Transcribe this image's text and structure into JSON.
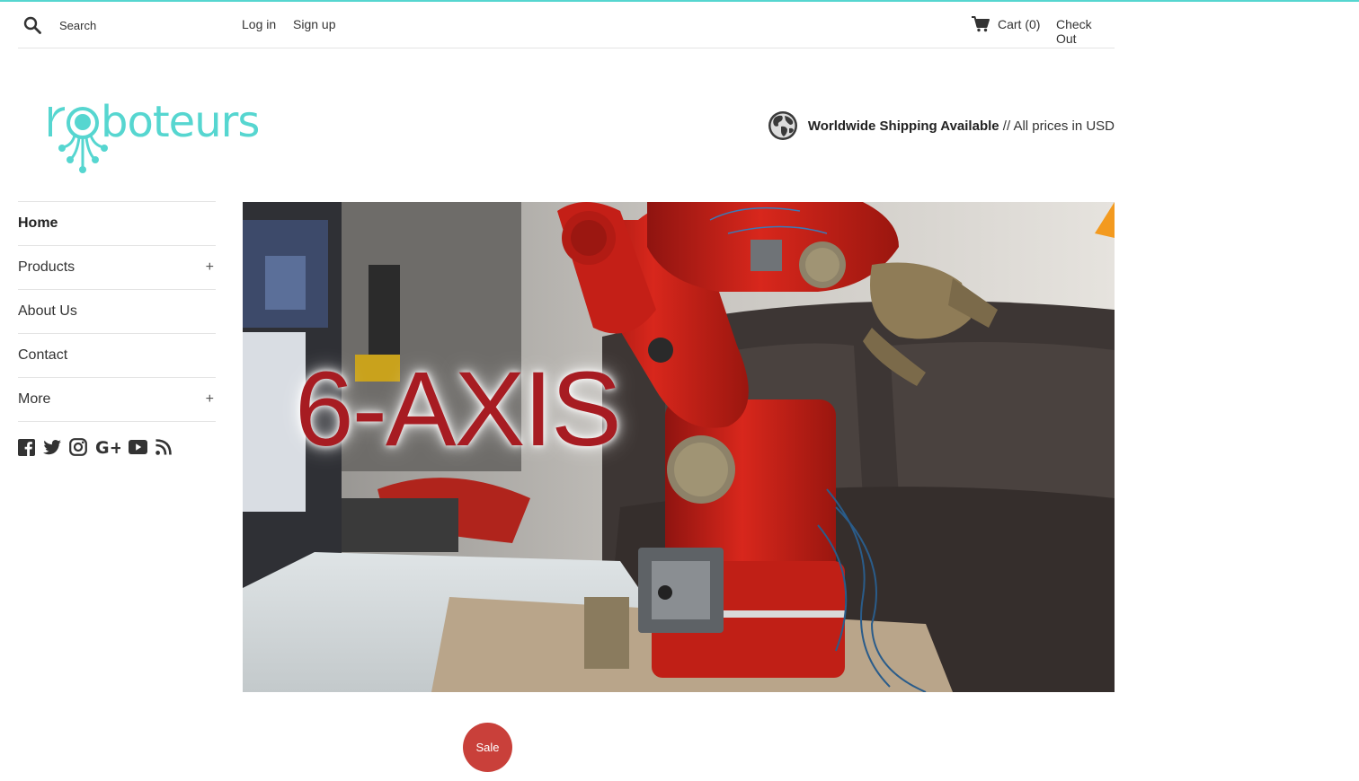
{
  "header": {
    "search_placeholder": "Search",
    "login": "Log in",
    "signup": "Sign up",
    "cart": "Cart (0)",
    "checkout": "Check Out"
  },
  "brand": {
    "logo_text": "roboteurs",
    "accent_color": "#56d6d0"
  },
  "shipping": {
    "bold": "Worldwide Shipping Available",
    "rest": " // All prices in USD"
  },
  "sidebar": {
    "items": [
      {
        "label": "Home",
        "active": true,
        "expandable": false
      },
      {
        "label": "Products",
        "active": false,
        "expandable": true
      },
      {
        "label": "About Us",
        "active": false,
        "expandable": false
      },
      {
        "label": "Contact",
        "active": false,
        "expandable": false
      },
      {
        "label": "More",
        "active": false,
        "expandable": true
      }
    ],
    "expand_symbol": "+",
    "social_icons": [
      "facebook-icon",
      "twitter-icon",
      "instagram-icon",
      "google-plus-icon",
      "youtube-icon",
      "rss-icon"
    ]
  },
  "hero": {
    "overlay_text": "6-AXIS"
  },
  "badge": {
    "label": "Sale",
    "color": "#c9403a"
  }
}
